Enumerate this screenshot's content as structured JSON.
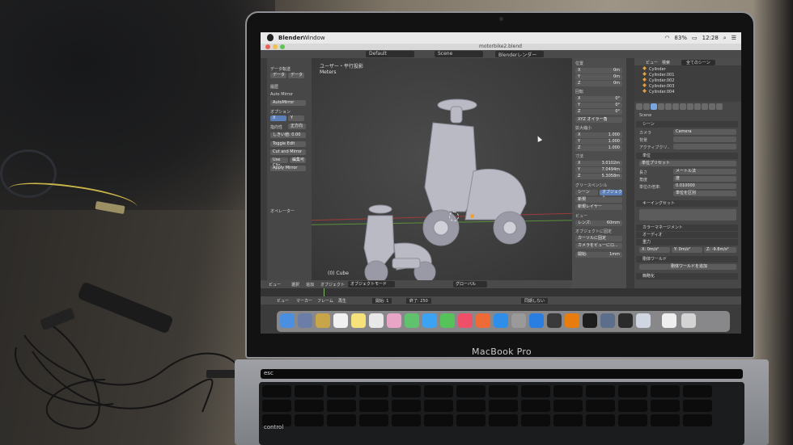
{
  "menubar": {
    "app_name": "Blender",
    "menu_window": "Window",
    "battery": "83%",
    "clock": "12:28"
  },
  "window": {
    "title": "motorbike2.blend"
  },
  "info_header": {
    "layout": "Default",
    "scene": "Scene",
    "engine": "Blenderレンダー"
  },
  "viewport": {
    "view_name": "ユーザー・平行投影",
    "units": "Meters",
    "active_object": "(0) Cube"
  },
  "tool_shelf": {
    "data_transfer": "データ転送",
    "data_btn": "データ",
    "data_btn2": "データ",
    "history": "履歴",
    "auto_mirror": "Auto Mirror",
    "auto_mirror_btn": "AutoMirror",
    "options": "オプション",
    "axis_x": "X",
    "axis_y": "Y",
    "orientation_label": "指向性",
    "orientation_value": "正方向",
    "threshold": "しきい値: 0.00",
    "toggle_edit": "Toggle Edit",
    "cut_and_mirror": "Cut and Mirror",
    "use_clip": "Use Clip",
    "edit_btn": "編集可",
    "apply_mirror": "Apply Mirror",
    "operator": "オペレーター"
  },
  "viewport_header": {
    "view": "ビュー",
    "select": "選択",
    "add": "追加",
    "object": "オブジェクト",
    "mode": "オブジェクトモード",
    "orientation": "グローバル"
  },
  "timeline": {
    "view": "ビュー",
    "marker": "マーカー",
    "frame": "フレーム",
    "playback": "再生",
    "start": "開始: 1",
    "end": "終了: 250",
    "sync": "同期しない"
  },
  "npanel": {
    "location": "位置",
    "rotation": "回転",
    "rotation_mode": "XYZ オイラー角",
    "scale": "拡大縮小",
    "dimensions": "寸法",
    "grease_pencil": "グリースペンシル",
    "scene_btn": "シーン",
    "object_btn": "オブジェクト",
    "new_btn": "新規",
    "new_layer": "新規レイヤー",
    "view_section": "ビュー",
    "lens": "レンズ:",
    "lens_value": "60mm",
    "lock_to_object": "オブジェクトに固定",
    "lock_cursor": "カーソルに固定",
    "lock_camera": "カメラをビューにロ...",
    "clip_start": "開始:",
    "clip_end": "1mm",
    "loc_x": "0m",
    "loc_y": "0m",
    "loc_z": "0m",
    "rot_x": "0°",
    "rot_y": "0°",
    "rot_z": "0°",
    "scale_x": "1.000",
    "scale_y": "1.000",
    "scale_z": "1.000",
    "dim_x": "3.0102m",
    "dim_y": "7.0494m",
    "dim_z": "5.3058m"
  },
  "outliner": {
    "view": "ビュー",
    "search": "検索",
    "filter": "全てのシーン",
    "items": [
      "Cylinder",
      "Cylinder.001",
      "Cylinder.002",
      "Cylinder.003",
      "Cylinder.004"
    ]
  },
  "properties": {
    "scene": "Scene",
    "scene_section": "シーン",
    "camera_label": "カメラ",
    "camera_value": "Camera",
    "background_label": "背景",
    "active_clip_label": "アクティブクリ..",
    "units_section": "単位",
    "unit_preset": "単位プリセット",
    "length_label": "長さ",
    "length_value": "メートル法",
    "angle_label": "角度",
    "angle_value": "度",
    "unit_scale_label": "単位の倍率:",
    "unit_scale_value": "0.010000",
    "separate_units": "単位を区別",
    "keying_sets": "キーイングセット",
    "color_management": "カラーマネージメント",
    "audio": "オーディオ",
    "gravity": "重力",
    "gravity_x": "X:",
    "gravity_x_val": "0m/s²",
    "gravity_y": "Y:",
    "gravity_y_val": "0m/s²",
    "gravity_z": "Z:",
    "gravity_z_val": "-9.8m/s²",
    "rigid_body_world": "剛体ワールド",
    "rigid_body_btn": "剛体ワールドを追加",
    "simplify": "簡略化"
  },
  "laptop": {
    "brand": "MacBook Pro",
    "key_esc": "esc",
    "key_control": "control"
  }
}
